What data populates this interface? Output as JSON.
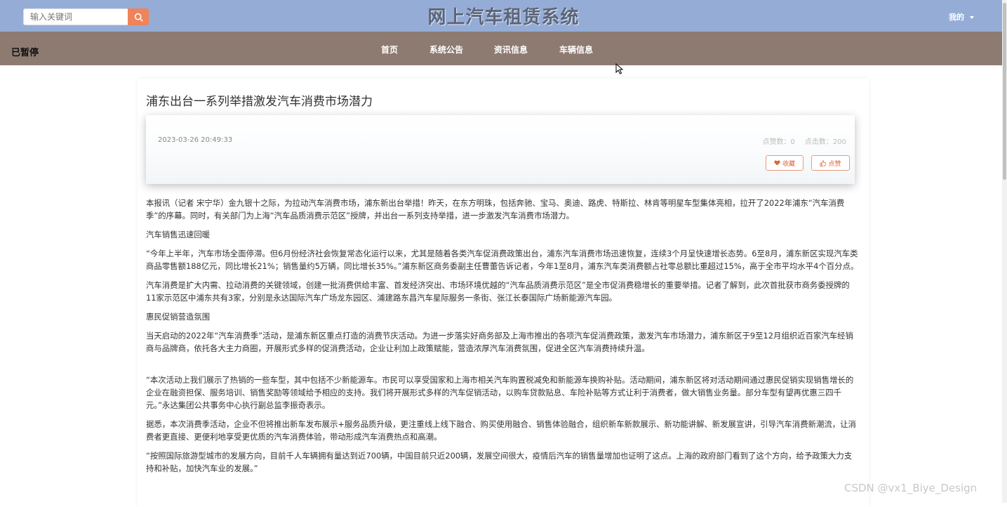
{
  "header": {
    "search_placeholder": "输入关键词",
    "site_title": "网上汽车租赁系统",
    "my_menu": "我的"
  },
  "nav": {
    "status": "已暂停",
    "items": [
      "首页",
      "系统公告",
      "资讯信息",
      "车辆信息"
    ]
  },
  "article": {
    "title": "浦东出台一系列举措激发汽车消费市场潜力",
    "date": "2023-03-26 20:49:33",
    "likes_label": "点赞数：0",
    "clicks_label": "点击数：200",
    "favorite_button": "收藏",
    "like_button": "点赞",
    "paragraphs": [
      "本报讯（记者 宋宁华）金九银十之际，为拉动汽车消费市场，浦东新出台举措！昨天，在东方明珠，包括奔驰、宝马、奥迪、路虎、特斯拉、林肯等明星车型集体亮相，拉开了2022年浦东“汽车消费季”的序幕。同时，有关部门为上海“汽车品质消费示范区”授牌，并出台一系列支持举措，进一步激发汽车消费市场潜力。",
      "汽车销售迅速回暖",
      "“今年上半年，汽车市场全面停滞。但6月份经济社会恢复常态化运行以来，尤其是随着各类汽车促消费政策出台，浦东汽车消费市场迅速恢复，连续3个月呈快速增长态势。6至8月，浦东新区实现汽车类商品零售额188亿元，同比增长21%；销售量约5万辆，同比增长35%。”浦东新区商务委副主任曹蕾告诉记者，今年1至8月，浦东汽车类消费额占社零总额比重超过15%，高于全市平均水平4个百分点。",
      "汽车消费是扩大内需、拉动消费的关键领域，创建一批消费供给丰富、首发经济突出、市场环境优越的“汽车品质消费示范区”是全市促消费稳增长的重要举措。记者了解到，此次首批获市商务委授牌的11家示范区中浦东共有3家，分别是永达国际汽车广场龙东园区、浦建路东昌汽车星际服务一条街、张江长泰国际广场新能源汽车园。",
      "惠民促销营造氛围",
      "当天启动的2022年“汽车消费季”活动，是浦东新区重点打造的消费节庆活动。为进一步落实好商务部及上海市推出的各项汽车促消费政策，激发汽车市场潜力，浦东新区于9至12月组织近百家汽车经销商与品牌商，依托各大主力商圈，开展形式多样的促消费活动，企业让利加上政策赋能，营造浓厚汽车消费氛围，促进全区汽车消费持续升温。",
      "“本次活动上我们展示了热销的一些车型，其中包括不少新能源车。市民可以享受国家和上海市相关汽车购置税减免和新能源车换购补贴。活动期间，浦东新区将对活动期间通过惠民促销实现销售增长的企业在融资担保、服务培训、销售奖励等领域给予相应的支持。我们将开展形式多样的汽车促销活动，以购车贷款贴息、车险补贴等方式让利于消费者，做大销售业务量。部分车型有望再优惠三四千元。”永达集团公共事务中心执行副总监李振奇表示。",
      "据悉，本次消费季活动，企业不但将推出新车发布展示+服务品质升级，更注重线上线下融合、购买使用融合、销售体验融合，组织新车新款展示、新功能讲解、新发展宣讲，引导汽车消费新潮流，让消费者更直接、更便利地享受更优质的汽车消费体验，带动形成汽车消费热点和高潮。",
      "“按照国际旅游型城市的发展方向，目前千人车辆拥有量达到近700辆，中国目前只近200辆，发展空间很大，疫情后汽车的销售量增加也证明了这点。上海的政府部门看到了这个方向，给予政策大力支持和补贴，加快汽车业的发展。”"
    ]
  },
  "watermark": "CSDN @vx1_Biye_Design"
}
